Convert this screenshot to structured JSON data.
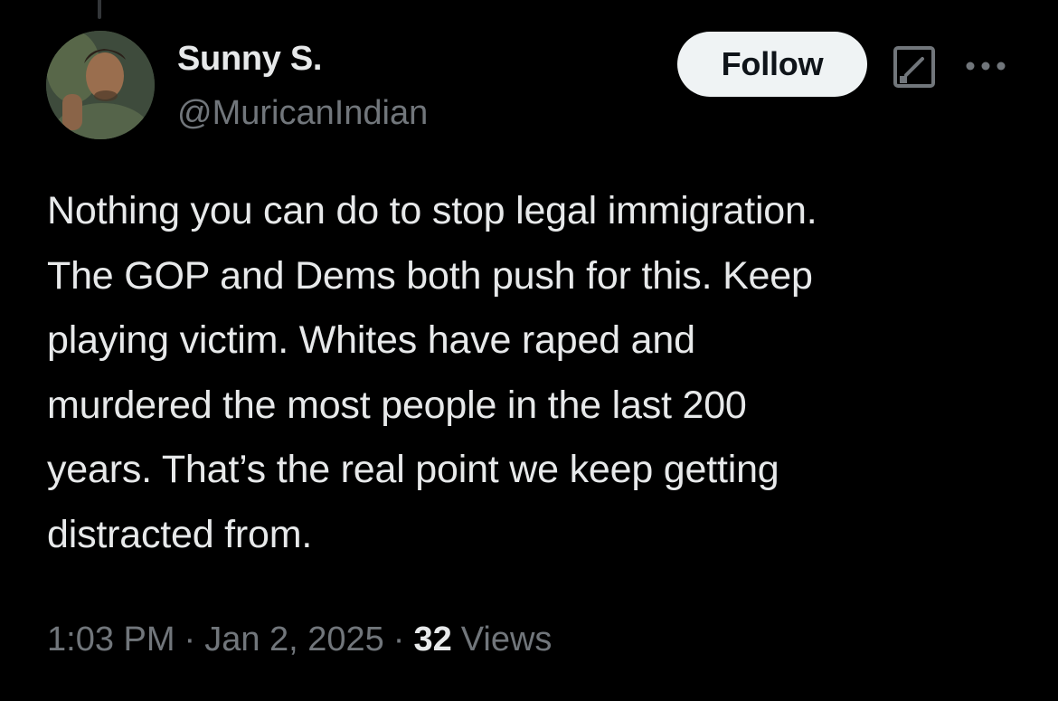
{
  "colors": {
    "background": "#000000",
    "primary_text": "#e7e9ea",
    "secondary_text": "#71767b",
    "follow_button_bg": "#eff3f4",
    "follow_button_text": "#0f1419"
  },
  "author": {
    "display_name": "Sunny S.",
    "handle": "@MuricanIndian",
    "avatar_icon": "user-avatar-photo"
  },
  "actions": {
    "follow_label": "Follow",
    "grok_icon": "grok-icon",
    "more_icon": "more-horizontal-icon"
  },
  "tweet": {
    "lines": [
      "Nothing you can do to stop legal immigration.",
      "The GOP and Dems both push for this. Keep",
      "playing victim. Whites have raped and",
      "murdered the most people in the last 200",
      "years. That’s the real point we keep getting",
      "distracted from."
    ]
  },
  "meta": {
    "time": "1:03 PM",
    "separator": "·",
    "date": "Jan 2, 2025",
    "views_count": "32",
    "views_label": "Views"
  }
}
